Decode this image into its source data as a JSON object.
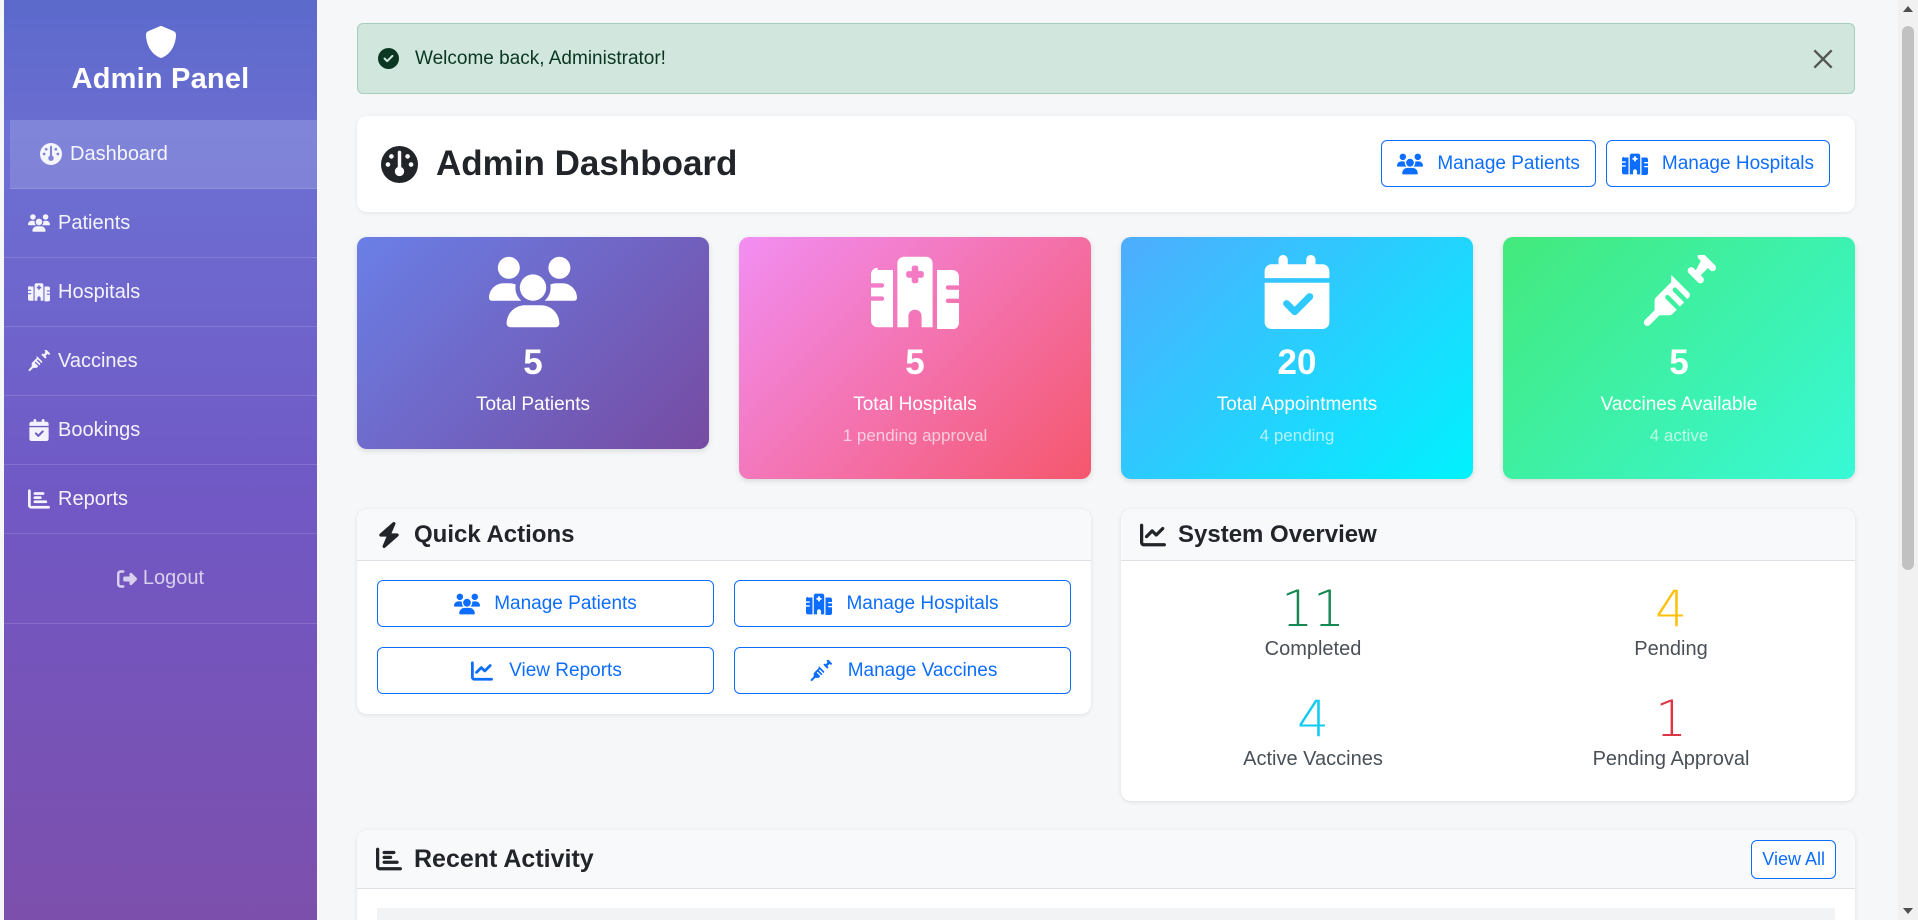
{
  "sidebar": {
    "brand_title": "Admin Panel",
    "items": [
      {
        "label": "Dashboard",
        "icon": "gauge-icon",
        "active": true
      },
      {
        "label": "Patients",
        "icon": "users-icon"
      },
      {
        "label": "Hospitals",
        "icon": "hospital-icon"
      },
      {
        "label": "Vaccines",
        "icon": "syringe-icon"
      },
      {
        "label": "Bookings",
        "icon": "calendar-check-icon"
      },
      {
        "label": "Reports",
        "icon": "chart-icon"
      }
    ],
    "logout_label": "Logout"
  },
  "alert": {
    "message": "Welcome back, Administrator!",
    "type": "success"
  },
  "header": {
    "title": "Admin Dashboard",
    "buttons": [
      "Manage Patients",
      "Manage Hospitals"
    ]
  },
  "stats": [
    {
      "value": "5",
      "label": "Total Patients",
      "sub": "",
      "icon": "users-icon",
      "color": "#6a7fe6"
    },
    {
      "value": "5",
      "label": "Total Hospitals",
      "sub": "1 pending approval",
      "icon": "hospital-icon",
      "color": "#f5576c"
    },
    {
      "value": "20",
      "label": "Total Appointments",
      "sub": "4 pending",
      "icon": "calendar-check-icon",
      "color": "#4facfe"
    },
    {
      "value": "5",
      "label": "Vaccines Available",
      "sub": "4 active",
      "icon": "syringe-icon",
      "color": "#43e97b"
    }
  ],
  "quick_actions": {
    "title": "Quick Actions",
    "buttons": [
      "Manage Patients",
      "Manage Hospitals",
      "View Reports",
      "Manage Vaccines"
    ]
  },
  "system_overview": {
    "title": "System Overview",
    "items": [
      {
        "value": "11",
        "label": "Completed",
        "color": "#198754"
      },
      {
        "value": "4",
        "label": "Pending",
        "color": "#ffc107"
      },
      {
        "value": "4",
        "label": "Active Vaccines",
        "color": "#0dcaf0"
      },
      {
        "value": "1",
        "label": "Pending Approval",
        "color": "#dc3545"
      }
    ]
  },
  "recent_activity": {
    "title": "Recent Activity",
    "view_all_label": "View All"
  }
}
